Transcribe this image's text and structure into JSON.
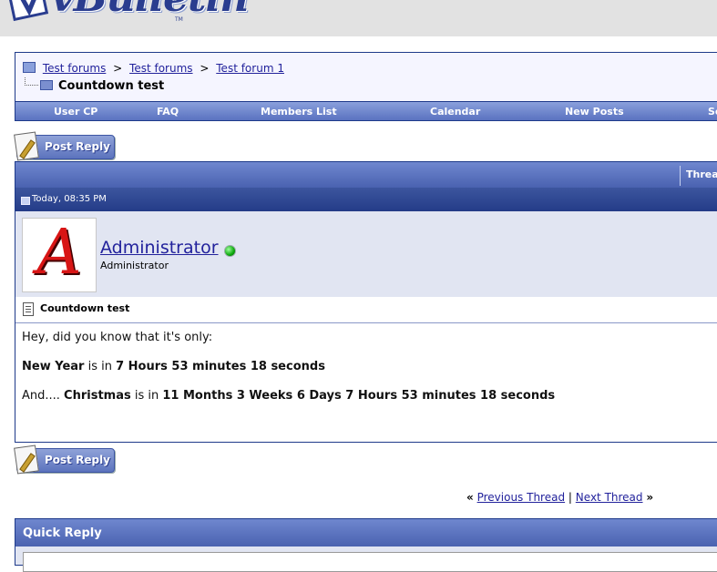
{
  "logo": {
    "text": "vBulletin",
    "tm": "TM"
  },
  "breadcrumb": {
    "items": [
      "Test forums",
      "Test forums",
      "Test forum 1"
    ],
    "separator": ">",
    "current": "Countdown test"
  },
  "navbar": {
    "items": [
      "User CP",
      "FAQ",
      "Members List",
      "Calendar",
      "New Posts",
      "Se"
    ]
  },
  "buttons": {
    "post_reply": "Post Reply"
  },
  "thread": {
    "tools_label": "Thread"
  },
  "post": {
    "date": "Today, 08:35 PM",
    "author": {
      "name": "Administrator",
      "title": "Administrator",
      "avatar_letter": "A"
    },
    "title": "Countdown test",
    "lines": {
      "intro": "Hey, did you know that it's only:",
      "newyear_event": "New Year",
      "newyear_mid": " is in ",
      "newyear_time": "7 Hours 53 minutes 18 seconds",
      "and_prefix": "And.... ",
      "xmas_event": "Christmas",
      "xmas_mid": " is in ",
      "xmas_time": "11 Months 3 Weeks 6 Days 7 Hours 53 minutes 18 seconds"
    }
  },
  "thread_nav": {
    "prev": "Previous Thread",
    "next": "Next Thread",
    "left_quote": "«",
    "right_quote": "»",
    "divider": "|"
  },
  "quick_reply": {
    "title": "Quick Reply"
  },
  "colors": {
    "link": "#22229c",
    "header_blue": "#4a62b0",
    "dark_blue": "#243c88",
    "online": "#0ca80c"
  }
}
